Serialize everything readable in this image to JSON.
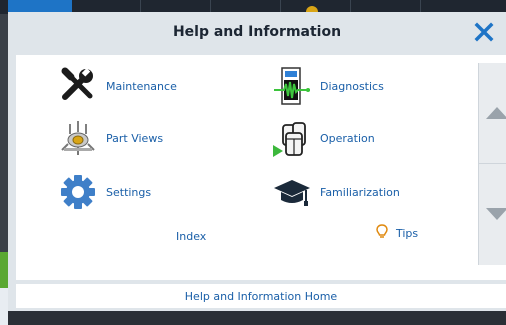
{
  "dialog": {
    "title": "Help and Information",
    "close_icon": "close-x-icon",
    "accent_color": "#1e74c6"
  },
  "topics": [
    {
      "label": "Maintenance",
      "icon": "wrench-screwdriver-icon"
    },
    {
      "label": "Diagnostics",
      "icon": "diagnostics-meter-icon"
    },
    {
      "label": "Part Views",
      "icon": "part-assembly-icon"
    },
    {
      "label": "Operation",
      "icon": "operation-containers-icon"
    },
    {
      "label": "Settings",
      "icon": "gear-icon"
    },
    {
      "label": "Familiarization",
      "icon": "graduation-cap-icon"
    }
  ],
  "links": {
    "index": "Index",
    "tips": "Tips",
    "tips_icon": "lightbulb-icon"
  },
  "scroll": {
    "up_icon": "triangle-up-icon",
    "down_icon": "triangle-down-icon"
  },
  "footer": {
    "home_label": "Help and Information Home"
  }
}
